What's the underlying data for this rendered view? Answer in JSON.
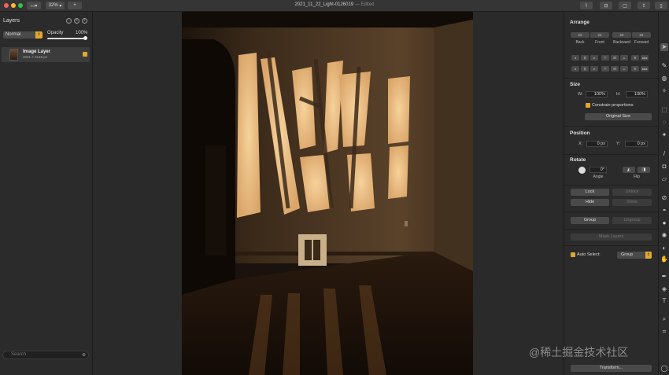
{
  "window": {
    "title": "2021_11_22_Light-0126019",
    "edited": "— Edited",
    "zoom": "32%",
    "add_label": "+"
  },
  "layers_panel": {
    "title": "Layers",
    "blend_mode": "Normal",
    "opacity_label": "Opacity",
    "opacity_value": "100%",
    "opacity_fraction": 1.0,
    "layer": {
      "name": "Image Layer",
      "size": "2021 × 3148 px"
    },
    "search_placeholder": "Search"
  },
  "inspector": {
    "arrange_title": "Arrange",
    "arrange_buttons": [
      "Back",
      "Front",
      "Backward",
      "Forward"
    ],
    "size_title": "Size",
    "w_label": "W:",
    "w_value": "100%",
    "h_label": "H:",
    "h_value": "100%",
    "constrain_label": "Constrain proportions",
    "original_size": "Original Size",
    "position_title": "Position",
    "x_label": "X:",
    "x_value": "0 px",
    "y_label": "Y:",
    "y_value": "0 px",
    "rotate_title": "Rotate",
    "angle_value": "0°",
    "angle_label": "Angle",
    "flip_label": "Flip",
    "lock": "Lock",
    "unlock": "Unlock",
    "hide": "Hide",
    "show": "Show",
    "group": "Group",
    "ungroup": "Ungroup",
    "mask_layers": "Mask Layers",
    "auto_select_label": "Auto Select:",
    "auto_select_value": "Group",
    "transform": "Transform..."
  },
  "watermark": "@稀土掘金技术社区",
  "colors": {
    "accent": "#e0a82e",
    "close": "#ff5f57",
    "minimize": "#febc2e",
    "zoom": "#28c840"
  }
}
